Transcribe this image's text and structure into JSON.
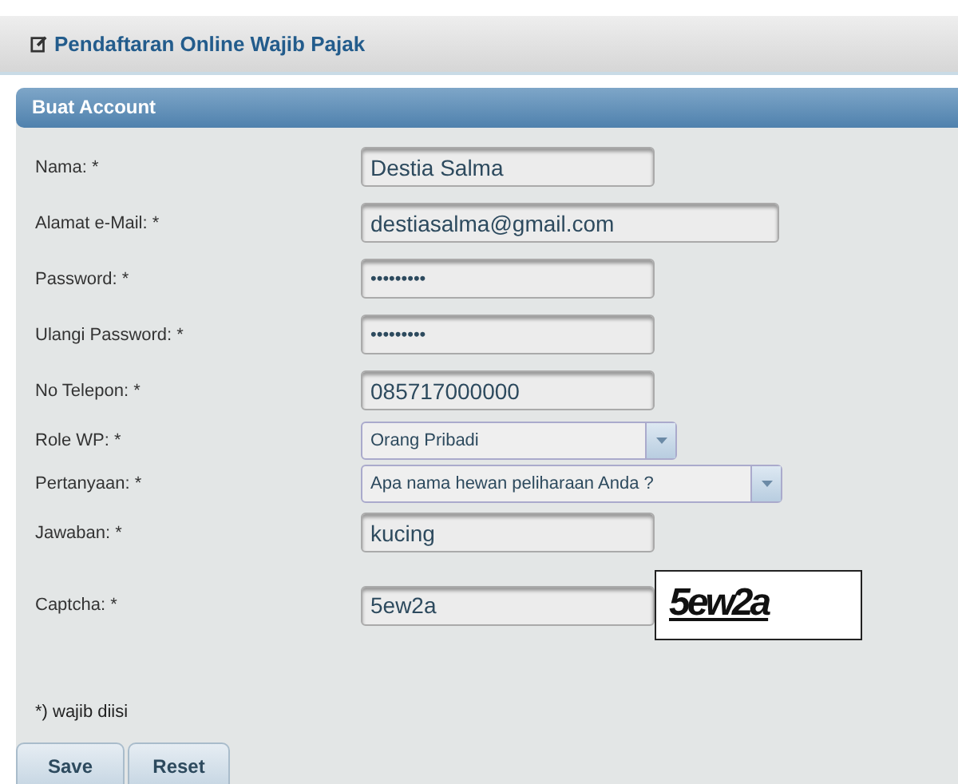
{
  "page_title": "Pendaftaran Online Wajib Pajak",
  "panel": {
    "title": "Buat Account",
    "fields": [
      {
        "kind": "text",
        "label": "Nama: *",
        "value": "Destia Salma",
        "wide": false
      },
      {
        "kind": "text",
        "label": "Alamat e-Mail: *",
        "value": "destiasalma@gmail.com",
        "wide": true
      },
      {
        "kind": "password",
        "label": "Password: *",
        "value": "•••••••••",
        "wide": false
      },
      {
        "kind": "password",
        "label": "Ulangi Password: *",
        "value": "•••••••••",
        "wide": false
      },
      {
        "kind": "text",
        "label": "No Telepon: *",
        "value": "085717000000",
        "wide": false
      },
      {
        "kind": "select",
        "label": "Role WP: *",
        "value": "Orang Pribadi",
        "wide": false
      },
      {
        "kind": "select",
        "label": "Pertanyaan: *",
        "value": "Apa nama hewan peliharaan Anda ?",
        "wide": true
      },
      {
        "kind": "text",
        "label": "Jawaban: *",
        "value": "kucing",
        "wide": false
      },
      {
        "kind": "captcha",
        "label": "Captcha: *",
        "value": "5ew2a",
        "captcha_image": "5ew2a",
        "wide": false
      }
    ],
    "note": "*) wajib diisi",
    "buttons": [
      "Save",
      "Reset"
    ]
  }
}
